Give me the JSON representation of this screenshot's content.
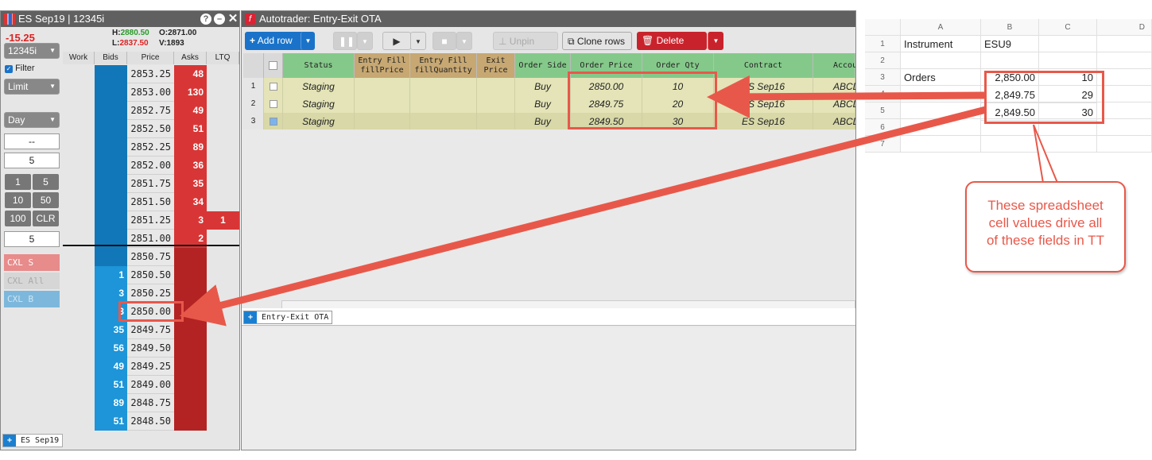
{
  "ladder": {
    "title": "ES Sep19 | 12345i",
    "change": "-15.25",
    "high_label": "H:",
    "high": "2880.50",
    "open_label": "O:",
    "open": "2871.00",
    "low_label": "L:",
    "low": "2837.50",
    "vol_label": "V:",
    "vol": "1893",
    "account": "12345i",
    "filter_label": "Filter",
    "order_type": "Limit",
    "tif": "Day",
    "dashes": "--",
    "qty_a": "5",
    "qty_buttons": [
      "1",
      "5",
      "10",
      "50",
      "100",
      "CLR"
    ],
    "qty_b": "5",
    "cxl_s": "CXL S",
    "cxl_all": "CXL All",
    "cxl_b": "CXL B",
    "columns": [
      "Work",
      "Bids",
      "Price",
      "Asks",
      "LTQ"
    ],
    "rows": [
      {
        "bid": "",
        "price": "2853.25",
        "ask": "48",
        "ltq": ""
      },
      {
        "bid": "",
        "price": "2853.00",
        "ask": "130",
        "ltq": ""
      },
      {
        "bid": "",
        "price": "2852.75",
        "ask": "49",
        "ltq": ""
      },
      {
        "bid": "",
        "price": "2852.50",
        "ask": "51",
        "ltq": ""
      },
      {
        "bid": "",
        "price": "2852.25",
        "ask": "89",
        "ltq": ""
      },
      {
        "bid": "",
        "price": "2852.00",
        "ask": "36",
        "ltq": ""
      },
      {
        "bid": "",
        "price": "2851.75",
        "ask": "35",
        "ltq": ""
      },
      {
        "bid": "",
        "price": "2851.50",
        "ask": "34",
        "ltq": ""
      },
      {
        "bid": "",
        "price": "2851.25",
        "ask": "3",
        "ltq": "1"
      },
      {
        "bid": "",
        "price": "2851.00",
        "ask": "2",
        "ltq": ""
      },
      {
        "bid": "",
        "price": "2850.75",
        "ask": "",
        "ltq": ""
      },
      {
        "bid": "1",
        "price": "2850.50",
        "ask": "",
        "ltq": ""
      },
      {
        "bid": "3",
        "price": "2850.25",
        "ask": "",
        "ltq": ""
      },
      {
        "bid": "3",
        "price": "2850.00",
        "ask": "",
        "ltq": ""
      },
      {
        "bid": "35",
        "price": "2849.75",
        "ask": "",
        "ltq": ""
      },
      {
        "bid": "56",
        "price": "2849.50",
        "ask": "",
        "ltq": ""
      },
      {
        "bid": "49",
        "price": "2849.25",
        "ask": "",
        "ltq": ""
      },
      {
        "bid": "51",
        "price": "2849.00",
        "ask": "",
        "ltq": ""
      },
      {
        "bid": "89",
        "price": "2848.75",
        "ask": "",
        "ltq": ""
      },
      {
        "bid": "51",
        "price": "2848.50",
        "ask": "",
        "ltq": ""
      }
    ],
    "footer_tab": "ES Sep19"
  },
  "autotrader": {
    "title": "Autotrader: Entry-Exit OTA",
    "add_row": "Add row",
    "unpin_rows": "Unpin rows",
    "clone_rows": "Clone rows",
    "delete_rows": "Delete rows",
    "columns": [
      "Status",
      "Entry Fill fillPrice",
      "Entry Fill fillQuantity",
      "Exit Price",
      "Order Side",
      "Order Price",
      "Order Qty",
      "Contract",
      "Accou"
    ],
    "rows": [
      {
        "n": "1",
        "status": "Staging",
        "side": "Buy",
        "price": "2850.00",
        "qty": "10",
        "contract": "ES Sep16",
        "account": "ABCDE"
      },
      {
        "n": "2",
        "status": "Staging",
        "side": "Buy",
        "price": "2849.75",
        "qty": "20",
        "contract": "ES Sep16",
        "account": "ABCDE"
      },
      {
        "n": "3",
        "status": "Staging",
        "side": "Buy",
        "price": "2849.50",
        "qty": "30",
        "contract": "ES Sep16",
        "account": "ABCDE"
      }
    ],
    "footer_tab": "Entry-Exit OTA"
  },
  "sheet": {
    "col_headers": [
      "A",
      "B",
      "C",
      "D"
    ],
    "row_numbers": [
      "1",
      "2",
      "3",
      "4",
      "5",
      "6",
      "7"
    ],
    "a1": "Instrument",
    "b1": "ESU9",
    "a3": "Orders",
    "prices": [
      "2,850.00",
      "2,849.75",
      "2,849.50"
    ],
    "qtys": [
      "10",
      "29",
      "30"
    ]
  },
  "callout": {
    "line1": "These spreadsheet",
    "line2": "cell values drive all",
    "line3": "of these fields in TT"
  },
  "colors": {
    "accent": "#e8584a",
    "bid": "#1277b8",
    "ask": "#b42323",
    "title_bar": "#606060"
  }
}
